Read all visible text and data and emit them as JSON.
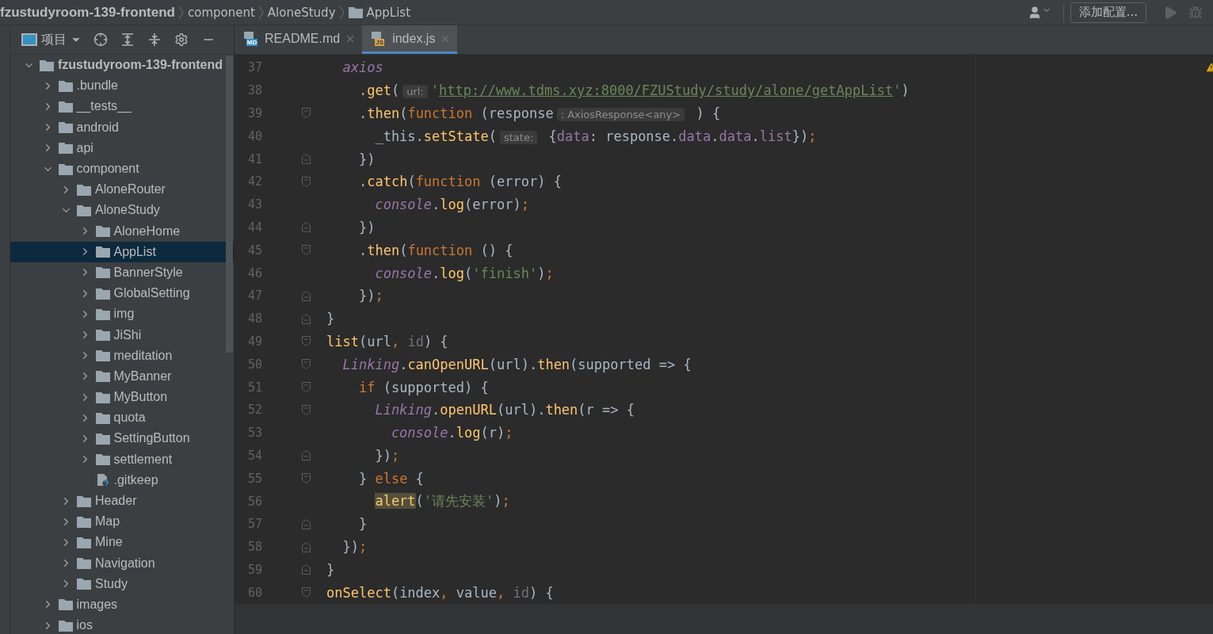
{
  "breadcrumbs": [
    {
      "label": "fzustudyroom-139-frontend",
      "kind": "project"
    },
    {
      "label": "component",
      "kind": "dir"
    },
    {
      "label": "AloneStudy",
      "kind": "dir"
    },
    {
      "label": "AppList",
      "kind": "folder"
    }
  ],
  "toolbar": {
    "run_config_button": "添加配置..."
  },
  "project_view": {
    "label": "项目"
  },
  "tree": [
    {
      "label": "fzustudyroom-139-frontend",
      "kind": "root",
      "expanded": true,
      "selected": false,
      "children": [
        {
          "label": ".bundle",
          "kind": "folder",
          "expanded": false,
          "selected": false
        },
        {
          "label": "__tests__",
          "kind": "folder",
          "expanded": false,
          "selected": false
        },
        {
          "label": "android",
          "kind": "folder",
          "expanded": false,
          "selected": false
        },
        {
          "label": "api",
          "kind": "folder",
          "expanded": false,
          "selected": false
        },
        {
          "label": "component",
          "kind": "folder",
          "expanded": true,
          "selected": false,
          "children": [
            {
              "label": "AloneRouter",
              "kind": "folder",
              "expanded": false,
              "selected": false
            },
            {
              "label": "AloneStudy",
              "kind": "folder",
              "expanded": true,
              "selected": false,
              "children": [
                {
                  "label": "AloneHome",
                  "kind": "folder",
                  "expanded": false,
                  "selected": false
                },
                {
                  "label": "AppList",
                  "kind": "folder",
                  "expanded": false,
                  "selected": true
                },
                {
                  "label": "BannerStyle",
                  "kind": "folder",
                  "expanded": false,
                  "selected": false
                },
                {
                  "label": "GlobalSetting",
                  "kind": "folder",
                  "expanded": false,
                  "selected": false
                },
                {
                  "label": "img",
                  "kind": "folder",
                  "expanded": false,
                  "selected": false
                },
                {
                  "label": "JiShi",
                  "kind": "folder",
                  "expanded": false,
                  "selected": false
                },
                {
                  "label": "meditation",
                  "kind": "folder",
                  "expanded": false,
                  "selected": false
                },
                {
                  "label": "MyBanner",
                  "kind": "folder",
                  "expanded": false,
                  "selected": false
                },
                {
                  "label": "MyButton",
                  "kind": "folder",
                  "expanded": false,
                  "selected": false
                },
                {
                  "label": "quota",
                  "kind": "folder",
                  "expanded": false,
                  "selected": false
                },
                {
                  "label": "SettingButton",
                  "kind": "folder",
                  "expanded": false,
                  "selected": false
                },
                {
                  "label": "settlement",
                  "kind": "folder",
                  "expanded": false,
                  "selected": false
                },
                {
                  "label": ".gitkeep",
                  "kind": "file",
                  "selected": false
                }
              ]
            },
            {
              "label": "Header",
              "kind": "folder",
              "expanded": false,
              "selected": false
            },
            {
              "label": "Map",
              "kind": "folder",
              "expanded": false,
              "selected": false
            },
            {
              "label": "Mine",
              "kind": "folder",
              "expanded": false,
              "selected": false
            },
            {
              "label": "Navigation",
              "kind": "folder",
              "expanded": false,
              "selected": false
            },
            {
              "label": "Study",
              "kind": "folder",
              "expanded": false,
              "selected": false
            }
          ]
        },
        {
          "label": "images",
          "kind": "folder",
          "expanded": false,
          "selected": false
        },
        {
          "label": "ios",
          "kind": "folder",
          "expanded": false,
          "selected": false
        }
      ]
    }
  ],
  "tabs": [
    {
      "label": "README.md",
      "badge": "MD",
      "kind": "md",
      "selected": false
    },
    {
      "label": "index.js",
      "badge": "JS",
      "kind": "js",
      "selected": true
    }
  ],
  "code_lines": [
    {
      "number": "37",
      "fold_start": false,
      "fold_end": false,
      "tokens": [
        {
          "kind": "global",
          "text": "  axios"
        }
      ]
    },
    {
      "number": "38",
      "fold_start": false,
      "fold_end": false,
      "tokens": [
        {
          "kind": "plain",
          "text": "    ."
        },
        {
          "kind": "method",
          "text": "get"
        },
        {
          "kind": "plain",
          "text": "("
        },
        {
          "kind": "hint",
          "text": "url:"
        },
        {
          "kind": "string",
          "text": "'"
        },
        {
          "kind": "url",
          "text": "http://www.tdms.xyz:8000/FZUStudy/study/alone/getAppList"
        },
        {
          "kind": "string",
          "text": "'"
        },
        {
          "kind": "plain",
          "text": ")"
        }
      ]
    },
    {
      "number": "39",
      "fold_start": true,
      "fold_end": false,
      "tokens": [
        {
          "kind": "plain",
          "text": "    ."
        },
        {
          "kind": "method",
          "text": "then"
        },
        {
          "kind": "plain",
          "text": "("
        },
        {
          "kind": "keyword",
          "text": "function"
        },
        {
          "kind": "plain",
          "text": " (response"
        },
        {
          "kind": "hint",
          "text": ": AxiosResponse<any>"
        },
        {
          "kind": "plain",
          "text": " ) {"
        }
      ]
    },
    {
      "number": "40",
      "fold_start": false,
      "fold_end": false,
      "tokens": [
        {
          "kind": "plain",
          "text": "      _this."
        },
        {
          "kind": "method",
          "text": "setState"
        },
        {
          "kind": "plain",
          "text": "("
        },
        {
          "kind": "hint",
          "text": "state:"
        },
        {
          "kind": "plain",
          "text": " {"
        },
        {
          "kind": "field",
          "text": "data"
        },
        {
          "kind": "plain",
          "text": ": response."
        },
        {
          "kind": "field",
          "text": "data"
        },
        {
          "kind": "plain",
          "text": "."
        },
        {
          "kind": "field",
          "text": "data"
        },
        {
          "kind": "plain",
          "text": "."
        },
        {
          "kind": "field",
          "text": "list"
        },
        {
          "kind": "plain",
          "text": "})"
        },
        {
          "kind": "punct",
          "text": ";"
        }
      ]
    },
    {
      "number": "41",
      "fold_start": false,
      "fold_end": true,
      "tokens": [
        {
          "kind": "plain",
          "text": "    })"
        }
      ]
    },
    {
      "number": "42",
      "fold_start": true,
      "fold_end": false,
      "tokens": [
        {
          "kind": "plain",
          "text": "    ."
        },
        {
          "kind": "method",
          "text": "catch"
        },
        {
          "kind": "plain",
          "text": "("
        },
        {
          "kind": "keyword",
          "text": "function"
        },
        {
          "kind": "plain",
          "text": " (error) {"
        }
      ]
    },
    {
      "number": "43",
      "fold_start": false,
      "fold_end": false,
      "tokens": [
        {
          "kind": "global",
          "text": "      console"
        },
        {
          "kind": "plain",
          "text": "."
        },
        {
          "kind": "method",
          "text": "log"
        },
        {
          "kind": "plain",
          "text": "(error)"
        },
        {
          "kind": "punct",
          "text": ";"
        }
      ]
    },
    {
      "number": "44",
      "fold_start": false,
      "fold_end": true,
      "tokens": [
        {
          "kind": "plain",
          "text": "    })"
        }
      ]
    },
    {
      "number": "45",
      "fold_start": true,
      "fold_end": false,
      "tokens": [
        {
          "kind": "plain",
          "text": "    ."
        },
        {
          "kind": "method",
          "text": "then"
        },
        {
          "kind": "plain",
          "text": "("
        },
        {
          "kind": "keyword",
          "text": "function"
        },
        {
          "kind": "plain",
          "text": " () {"
        }
      ]
    },
    {
      "number": "46",
      "fold_start": false,
      "fold_end": false,
      "tokens": [
        {
          "kind": "global",
          "text": "      console"
        },
        {
          "kind": "plain",
          "text": "."
        },
        {
          "kind": "method",
          "text": "log"
        },
        {
          "kind": "plain",
          "text": "("
        },
        {
          "kind": "string",
          "text": "'finish'"
        },
        {
          "kind": "plain",
          "text": ")"
        },
        {
          "kind": "punct",
          "text": ";"
        }
      ]
    },
    {
      "number": "47",
      "fold_start": false,
      "fold_end": true,
      "tokens": [
        {
          "kind": "plain",
          "text": "    })"
        },
        {
          "kind": "punct",
          "text": ";"
        }
      ]
    },
    {
      "number": "48",
      "fold_start": false,
      "fold_end": true,
      "tokens": [
        {
          "kind": "plain",
          "text": "}"
        }
      ]
    },
    {
      "number": "49",
      "fold_start": true,
      "fold_end": false,
      "tokens": [
        {
          "kind": "method",
          "text": "list"
        },
        {
          "kind": "plain",
          "text": "(url"
        },
        {
          "kind": "punct",
          "text": ","
        },
        {
          "kind": "unused",
          "text": " id"
        },
        {
          "kind": "plain",
          "text": ") {"
        }
      ]
    },
    {
      "number": "50",
      "fold_start": true,
      "fold_end": false,
      "tokens": [
        {
          "kind": "global",
          "text": "  Linking"
        },
        {
          "kind": "plain",
          "text": "."
        },
        {
          "kind": "method",
          "text": "canOpenURL"
        },
        {
          "kind": "plain",
          "text": "(url)."
        },
        {
          "kind": "method",
          "text": "then"
        },
        {
          "kind": "plain",
          "text": "(supported => {"
        }
      ]
    },
    {
      "number": "51",
      "fold_start": true,
      "fold_end": false,
      "tokens": [
        {
          "kind": "keyword",
          "text": "    if"
        },
        {
          "kind": "plain",
          "text": " (supported) {"
        }
      ]
    },
    {
      "number": "52",
      "fold_start": true,
      "fold_end": false,
      "tokens": [
        {
          "kind": "global",
          "text": "      Linking"
        },
        {
          "kind": "plain",
          "text": "."
        },
        {
          "kind": "method",
          "text": "openURL"
        },
        {
          "kind": "plain",
          "text": "(url)."
        },
        {
          "kind": "method",
          "text": "then"
        },
        {
          "kind": "plain",
          "text": "(r => {"
        }
      ]
    },
    {
      "number": "53",
      "fold_start": false,
      "fold_end": false,
      "tokens": [
        {
          "kind": "global",
          "text": "        console"
        },
        {
          "kind": "plain",
          "text": "."
        },
        {
          "kind": "method",
          "text": "log"
        },
        {
          "kind": "plain",
          "text": "(r)"
        },
        {
          "kind": "punct",
          "text": ";"
        }
      ]
    },
    {
      "number": "54",
      "fold_start": false,
      "fold_end": true,
      "tokens": [
        {
          "kind": "plain",
          "text": "      })"
        },
        {
          "kind": "punct",
          "text": ";"
        }
      ]
    },
    {
      "number": "55",
      "fold_start": true,
      "fold_end": false,
      "tokens": [
        {
          "kind": "plain",
          "text": "    } "
        },
        {
          "kind": "keyword",
          "text": "else"
        },
        {
          "kind": "plain",
          "text": " {"
        }
      ]
    },
    {
      "number": "56",
      "fold_start": false,
      "fold_end": false,
      "tokens": [
        {
          "kind": "highlight",
          "text": "      alert"
        },
        {
          "kind": "plain",
          "text": "("
        },
        {
          "kind": "string",
          "text": "'请先安装'"
        },
        {
          "kind": "plain",
          "text": ")"
        },
        {
          "kind": "punct",
          "text": ";"
        }
      ]
    },
    {
      "number": "57",
      "fold_start": false,
      "fold_end": true,
      "tokens": [
        {
          "kind": "plain",
          "text": "    }"
        }
      ]
    },
    {
      "number": "58",
      "fold_start": false,
      "fold_end": true,
      "tokens": [
        {
          "kind": "plain",
          "text": "  })"
        },
        {
          "kind": "punct",
          "text": ";"
        }
      ]
    },
    {
      "number": "59",
      "fold_start": false,
      "fold_end": true,
      "tokens": [
        {
          "kind": "plain",
          "text": "}"
        }
      ]
    },
    {
      "number": "60",
      "fold_start": true,
      "fold_end": false,
      "tokens": [
        {
          "kind": "method",
          "text": "onSelect"
        },
        {
          "kind": "plain",
          "text": "(index"
        },
        {
          "kind": "punct",
          "text": ","
        },
        {
          "kind": "plain",
          "text": " value"
        },
        {
          "kind": "punct",
          "text": ","
        },
        {
          "kind": "unused",
          "text": " id"
        },
        {
          "kind": "plain",
          "text": ") {"
        }
      ]
    }
  ]
}
